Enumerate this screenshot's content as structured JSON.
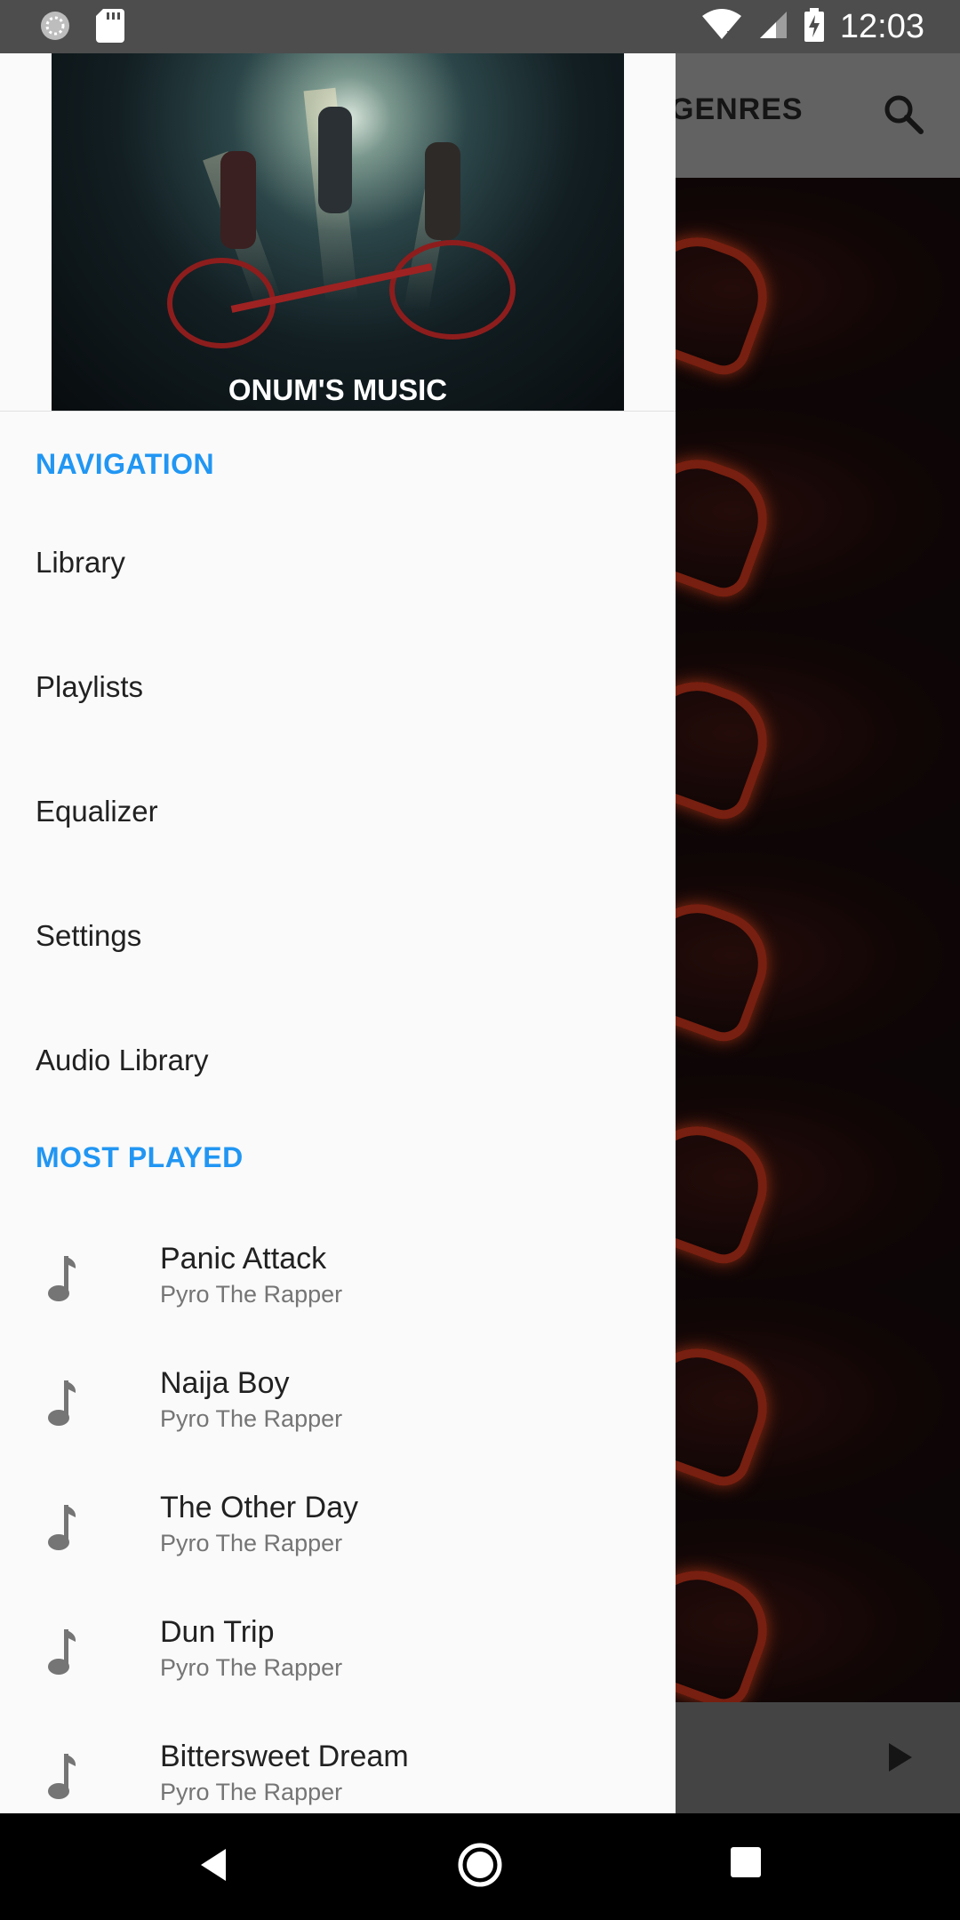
{
  "status_bar": {
    "time": "12:03",
    "icons": [
      "sync-icon",
      "sd-card-icon",
      "wifi-icon",
      "signal-icon",
      "battery-charging-icon"
    ]
  },
  "background_app": {
    "tab_label": "GENRES",
    "search_icon": "search-icon",
    "play_icon": "play-icon"
  },
  "drawer": {
    "header_title": "ONUM'S MUSIC",
    "navigation": {
      "heading": "NAVIGATION",
      "items": [
        {
          "label": "Library"
        },
        {
          "label": "Playlists"
        },
        {
          "label": "Equalizer"
        },
        {
          "label": "Settings"
        },
        {
          "label": "Audio Library"
        }
      ]
    },
    "most_played": {
      "heading": "MOST PLAYED",
      "songs": [
        {
          "title": "Panic Attack",
          "artist": "Pyro The Rapper"
        },
        {
          "title": "Naija Boy",
          "artist": "Pyro The Rapper"
        },
        {
          "title": "The Other Day",
          "artist": "Pyro The Rapper"
        },
        {
          "title": "Dun Trip",
          "artist": "Pyro The Rapper"
        },
        {
          "title": "Bittersweet Dream",
          "artist": "Pyro The Rapper"
        }
      ]
    },
    "accent_color": "#2196f3"
  },
  "nav_bar": {
    "icons": [
      "back-icon",
      "home-icon",
      "recents-icon"
    ]
  }
}
